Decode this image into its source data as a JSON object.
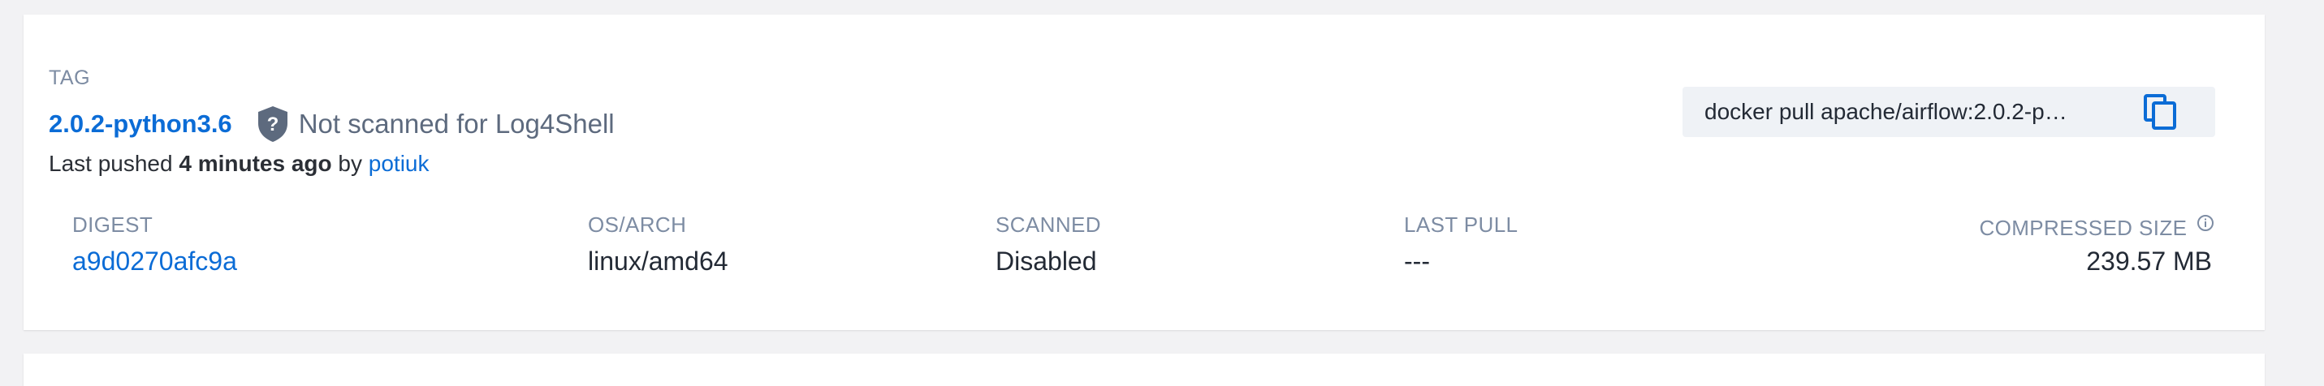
{
  "tag": {
    "section_label": "TAG",
    "name": "2.0.2-python3.6",
    "scan_status": "Not scanned for Log4Shell",
    "pushed_prefix": "Last pushed",
    "pushed_time": "4 minutes ago",
    "pushed_by_word": "by",
    "pushed_user": "potiuk"
  },
  "pull_command": {
    "text": "docker pull apache/airflow:2.0.2-pyt..."
  },
  "columns": {
    "digest": {
      "header": "DIGEST",
      "value": "a9d0270afc9a"
    },
    "os_arch": {
      "header": "OS/ARCH",
      "value": "linux/amd64"
    },
    "scanned": {
      "header": "SCANNED",
      "value": "Disabled"
    },
    "last_pull": {
      "header": "LAST PULL",
      "value": "---"
    },
    "compressed_size": {
      "header": "COMPRESSED SIZE",
      "value": "239.57 MB"
    }
  },
  "icons": {
    "shield": "shield-question-icon",
    "copy": "copy-icon",
    "info": "info-icon"
  },
  "colors": {
    "link": "#0b6cd6",
    "muted": "#7d8ca3",
    "shield": "#5d6a7e"
  }
}
